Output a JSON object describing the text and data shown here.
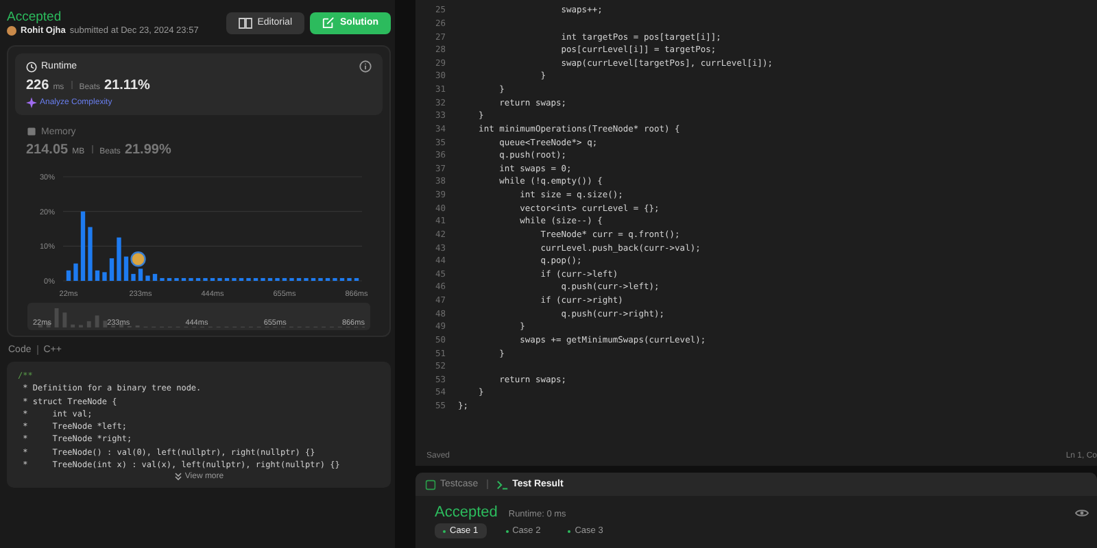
{
  "header": {
    "status": "Accepted",
    "author": "Rohit Ojha",
    "submitted": "submitted at Dec 23, 2024 23:57",
    "buttons": [
      {
        "label": "Editorial",
        "kind": "secondary"
      },
      {
        "label": "Solution",
        "kind": "primary"
      }
    ]
  },
  "metrics": [
    {
      "kind": "runtime",
      "title": "Runtime",
      "value": "226",
      "unit": "ms",
      "beats_label": "Beats",
      "beats": "21.11%",
      "selected": true,
      "link": "Analyze Complexity"
    },
    {
      "kind": "memory",
      "title": "Memory",
      "value": "214.05",
      "unit": "MB",
      "beats_label": "Beats",
      "beats": "21.99%",
      "selected": false
    }
  ],
  "chart_data": {
    "type": "bar",
    "ylim": [
      0,
      30
    ],
    "yticks": [
      {
        "value": 0,
        "label": "0%"
      },
      {
        "value": 10,
        "label": "10%"
      },
      {
        "value": 20,
        "label": "20%"
      },
      {
        "value": 30,
        "label": "30%"
      }
    ],
    "xlim": [
      22,
      866
    ],
    "xticks": [
      {
        "value": 22,
        "label": "22ms"
      },
      {
        "value": 233,
        "label": "233ms"
      },
      {
        "value": 444,
        "label": "444ms"
      },
      {
        "value": 655,
        "label": "655ms"
      },
      {
        "value": 866,
        "label": "866ms"
      }
    ],
    "x": [
      22,
      43.1,
      64.2,
      85.3,
      106.4,
      127.5,
      148.6,
      169.7,
      190.8,
      211.9,
      233,
      254.1,
      275.2,
      296.3,
      317.4,
      338.5,
      359.6,
      380.7,
      401.8,
      422.9,
      444,
      465.1,
      486.2,
      507.3,
      528.4,
      549.5,
      570.6,
      591.7,
      612.8,
      633.9,
      655,
      676.1,
      697.2,
      718.3,
      739.4,
      760.5,
      781.6,
      802.7,
      823.8,
      844.9,
      866
    ],
    "values": [
      3,
      5,
      20,
      15.5,
      3,
      2.5,
      6.5,
      12.5,
      7,
      2,
      3.5,
      1.5,
      2,
      0.8,
      0.8,
      0.8,
      0.8,
      0.8,
      0.8,
      0.8,
      0.8,
      0.8,
      0.8,
      0.8,
      0.8,
      0.8,
      0.8,
      0.8,
      0.8,
      0.8,
      0.8,
      0.8,
      0.8,
      0.8,
      0.8,
      0.8,
      0.8,
      0.8,
      0.8,
      0.8,
      0.8
    ]
  },
  "scrubber": {
    "labels": [
      "22ms",
      "233ms",
      "444ms",
      "655ms",
      "866ms"
    ]
  },
  "code_meta": {
    "label": "Code",
    "language": "C++"
  },
  "code_preview": {
    "lines": [
      "/**",
      " * Definition for a binary tree node.",
      " * struct TreeNode {",
      " *     int val;",
      " *     TreeNode *left;",
      " *     TreeNode *right;",
      " *     TreeNode() : val(0), left(nullptr), right(nullptr) {}",
      " *     TreeNode(int x) : val(x), left(nullptr), right(nullptr) {}"
    ],
    "more": "View more"
  },
  "editor": {
    "lines": [
      {
        "n": "25",
        "text": "                    swaps++;"
      },
      {
        "n": "26"
      },
      {
        "n": "27",
        "text": "                    int targetPos = pos[target[i]];"
      },
      {
        "n": "28",
        "text": "                    pos[currLevel[i]] = targetPos;"
      },
      {
        "n": "29",
        "text": "                    swap(currLevel[targetPos], currLevel[i]);"
      },
      {
        "n": "30",
        "text": "                }"
      },
      {
        "n": "31",
        "text": "        }"
      },
      {
        "n": "32",
        "text": "        return swaps;"
      },
      {
        "n": "33",
        "text": "    }"
      },
      {
        "n": "34",
        "text": "    int minimumOperations(TreeNode* root) {"
      },
      {
        "n": "35",
        "text": "        queue<TreeNode*> q;"
      },
      {
        "n": "36",
        "text": "        q.push(root);"
      },
      {
        "n": "37",
        "text": "        int swaps = 0;"
      },
      {
        "n": "38",
        "text": "        while (!q.empty()) {"
      },
      {
        "n": "39",
        "text": "            int size = q.size();"
      },
      {
        "n": "40",
        "text": "            vector<int> currLevel = {};"
      },
      {
        "n": "41",
        "text": "            while (size--) {"
      },
      {
        "n": "42",
        "text": "                TreeNode* curr = q.front();"
      },
      {
        "n": "43",
        "text": "                currLevel.push_back(curr->val);"
      },
      {
        "n": "44",
        "text": "                q.pop();"
      },
      {
        "n": "45",
        "text": "                if (curr->left)"
      },
      {
        "n": "46",
        "text": "                    q.push(curr->left);"
      },
      {
        "n": "47",
        "text": "                if (curr->right)"
      },
      {
        "n": "48",
        "text": "                    q.push(curr->right);"
      },
      {
        "n": "49",
        "text": "            }"
      },
      {
        "n": "50",
        "text": "            swaps += getMinimumSwaps(currLevel);"
      },
      {
        "n": "51",
        "text": "        }"
      },
      {
        "n": "52"
      },
      {
        "n": "53",
        "text": "        return swaps;"
      },
      {
        "n": "54",
        "text": "    }"
      },
      {
        "n": "55",
        "text": "};"
      }
    ],
    "status": "Saved",
    "position": "Ln 1, Co"
  },
  "result_panel": {
    "tabs": [
      {
        "label": "Testcase",
        "kind": "testcase",
        "selected": false
      },
      {
        "label": "Test Result",
        "kind": "result",
        "selected": true
      }
    ],
    "verdict": "Accepted",
    "runtime": "Runtime: 0 ms",
    "cases": [
      {
        "label": "Case 1",
        "selected": true
      },
      {
        "label": "Case 2",
        "selected": false
      },
      {
        "label": "Case 3",
        "selected": false
      }
    ]
  }
}
